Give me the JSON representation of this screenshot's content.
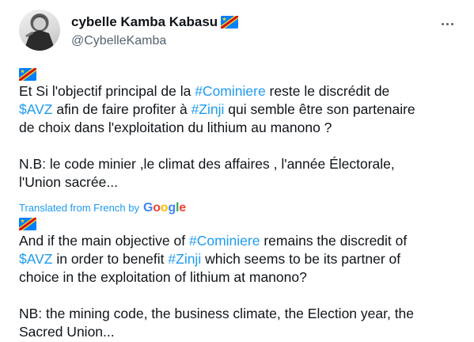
{
  "header": {
    "display_name": "cybelle Kamba Kabasu",
    "handle": "@CybelleKamba"
  },
  "original": {
    "line1": [
      {
        "t": "Et Si  l'objectif principal de la "
      },
      {
        "t": "#Cominiere",
        "tag": true
      },
      {
        "t": " reste le discrédit de"
      }
    ],
    "line2": [
      {
        "t": "$AVZ",
        "tag": true
      },
      {
        "t": " afin de faire profiter à "
      },
      {
        "t": "#Zinji",
        "tag": true
      },
      {
        "t": " qui semble être son partenaire"
      }
    ],
    "line3": "de choix dans l'exploitation du lithium au manono ?",
    "nb_line1": "N.B: le code minier ,le climat des affaires , l'année Électorale,",
    "nb_line2": "l'Union sacrée..."
  },
  "translated_label": "Translated from French by",
  "google_letters": [
    "G",
    "o",
    "o",
    "g",
    "l",
    "e"
  ],
  "translation": {
    "line1": [
      {
        "t": "And if the main objective of "
      },
      {
        "t": "#Cominiere",
        "tag": true
      },
      {
        "t": " remains the discredit of"
      }
    ],
    "line2": [
      {
        "t": "$AVZ",
        "tag": true
      },
      {
        "t": " in order to benefit "
      },
      {
        "t": "#Zinji",
        "tag": true
      },
      {
        "t": " which seems to be its partner of"
      }
    ],
    "line3": "choice in the exploitation of lithium at manono?",
    "nb_line1": "NB: the mining code, the business climate, the Election year, the",
    "nb_line2": "Sacred Union..."
  },
  "icons": {
    "flag": "dr-congo-flag-icon",
    "more": "more-options-icon"
  },
  "colors": {
    "link": "#1d9bf0",
    "text": "#0f1419",
    "muted": "#536471",
    "flag_blue": "#007fff",
    "flag_red": "#ce1021",
    "flag_yellow": "#f7d618"
  }
}
